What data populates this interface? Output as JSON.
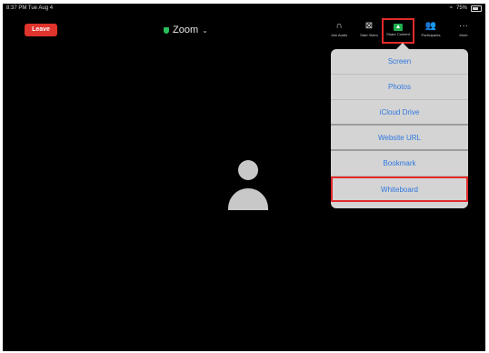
{
  "status_bar": {
    "time": "8:37 PM  Tue Aug 4",
    "battery": "75%"
  },
  "header": {
    "leave_label": "Leave",
    "meeting_title": "Zoom",
    "chevron": "⌄"
  },
  "toolbar": [
    {
      "label": "Join Audio",
      "icon": "headphones-icon"
    },
    {
      "label": "Start Video",
      "icon": "video-off-icon"
    },
    {
      "label": "Share Content",
      "icon": "share-screen-icon"
    },
    {
      "label": "Participants",
      "icon": "participants-icon"
    },
    {
      "label": "More",
      "icon": "more-icon"
    }
  ],
  "share_menu": {
    "items": [
      "Screen",
      "Photos",
      "iCloud Drive",
      "Website URL",
      "Bookmark",
      "Whiteboard"
    ]
  }
}
